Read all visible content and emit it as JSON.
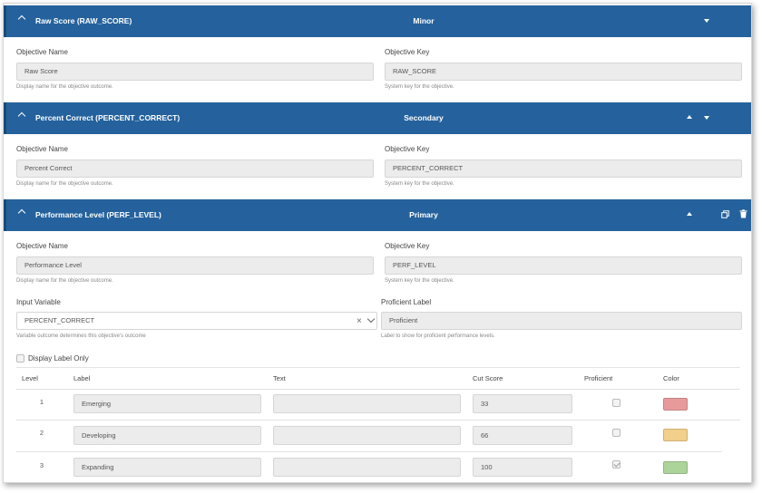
{
  "sections": [
    {
      "title": "Raw Score (RAW_SCORE)",
      "category": "Minor",
      "name_label": "Objective Name",
      "name_value": "Raw Score",
      "name_help": "Display name for the objective outcome.",
      "key_label": "Objective Key",
      "key_value": "RAW_SCORE",
      "key_help": "System key for the objective."
    },
    {
      "title": "Percent Correct (PERCENT_CORRECT)",
      "category": "Secondary",
      "name_label": "Objective Name",
      "name_value": "Percent Correct",
      "name_help": "Display name for the objective outcome.",
      "key_label": "Objective Key",
      "key_value": "PERCENT_CORRECT",
      "key_help": "System key for the objective."
    },
    {
      "title": "Performance Level (PERF_LEVEL)",
      "category": "Primary",
      "name_label": "Objective Name",
      "name_value": "Performance Level",
      "name_help": "Display name for the objective outcome.",
      "key_label": "Objective Key",
      "key_value": "PERF_LEVEL",
      "key_help": "System key for the objective."
    }
  ],
  "perf": {
    "input_variable_label": "Input Variable",
    "input_variable_value": "PERCENT_CORRECT",
    "input_variable_help": "Variable outcome determines this objective's outcome",
    "proficient_label": "Proficient Label",
    "proficient_value": "Proficient",
    "proficient_help": "Label to show for proficient performance levels.",
    "display_label_only": "Display Label Only",
    "columns": {
      "level": "Level",
      "label": "Label",
      "text": "Text",
      "cut_score": "Cut Score",
      "proficient": "Proficient",
      "color": "Color"
    },
    "rows": [
      {
        "level": "1",
        "label": "Emerging",
        "text": "",
        "cut_score": "33",
        "proficient": false,
        "color": "#e89a9a"
      },
      {
        "level": "2",
        "label": "Developing",
        "text": "",
        "cut_score": "66",
        "proficient": false,
        "color": "#f2cf8a"
      },
      {
        "level": "3",
        "label": "Expanding",
        "text": "",
        "cut_score": "100",
        "proficient": true,
        "color": "#acd49a"
      }
    ]
  }
}
